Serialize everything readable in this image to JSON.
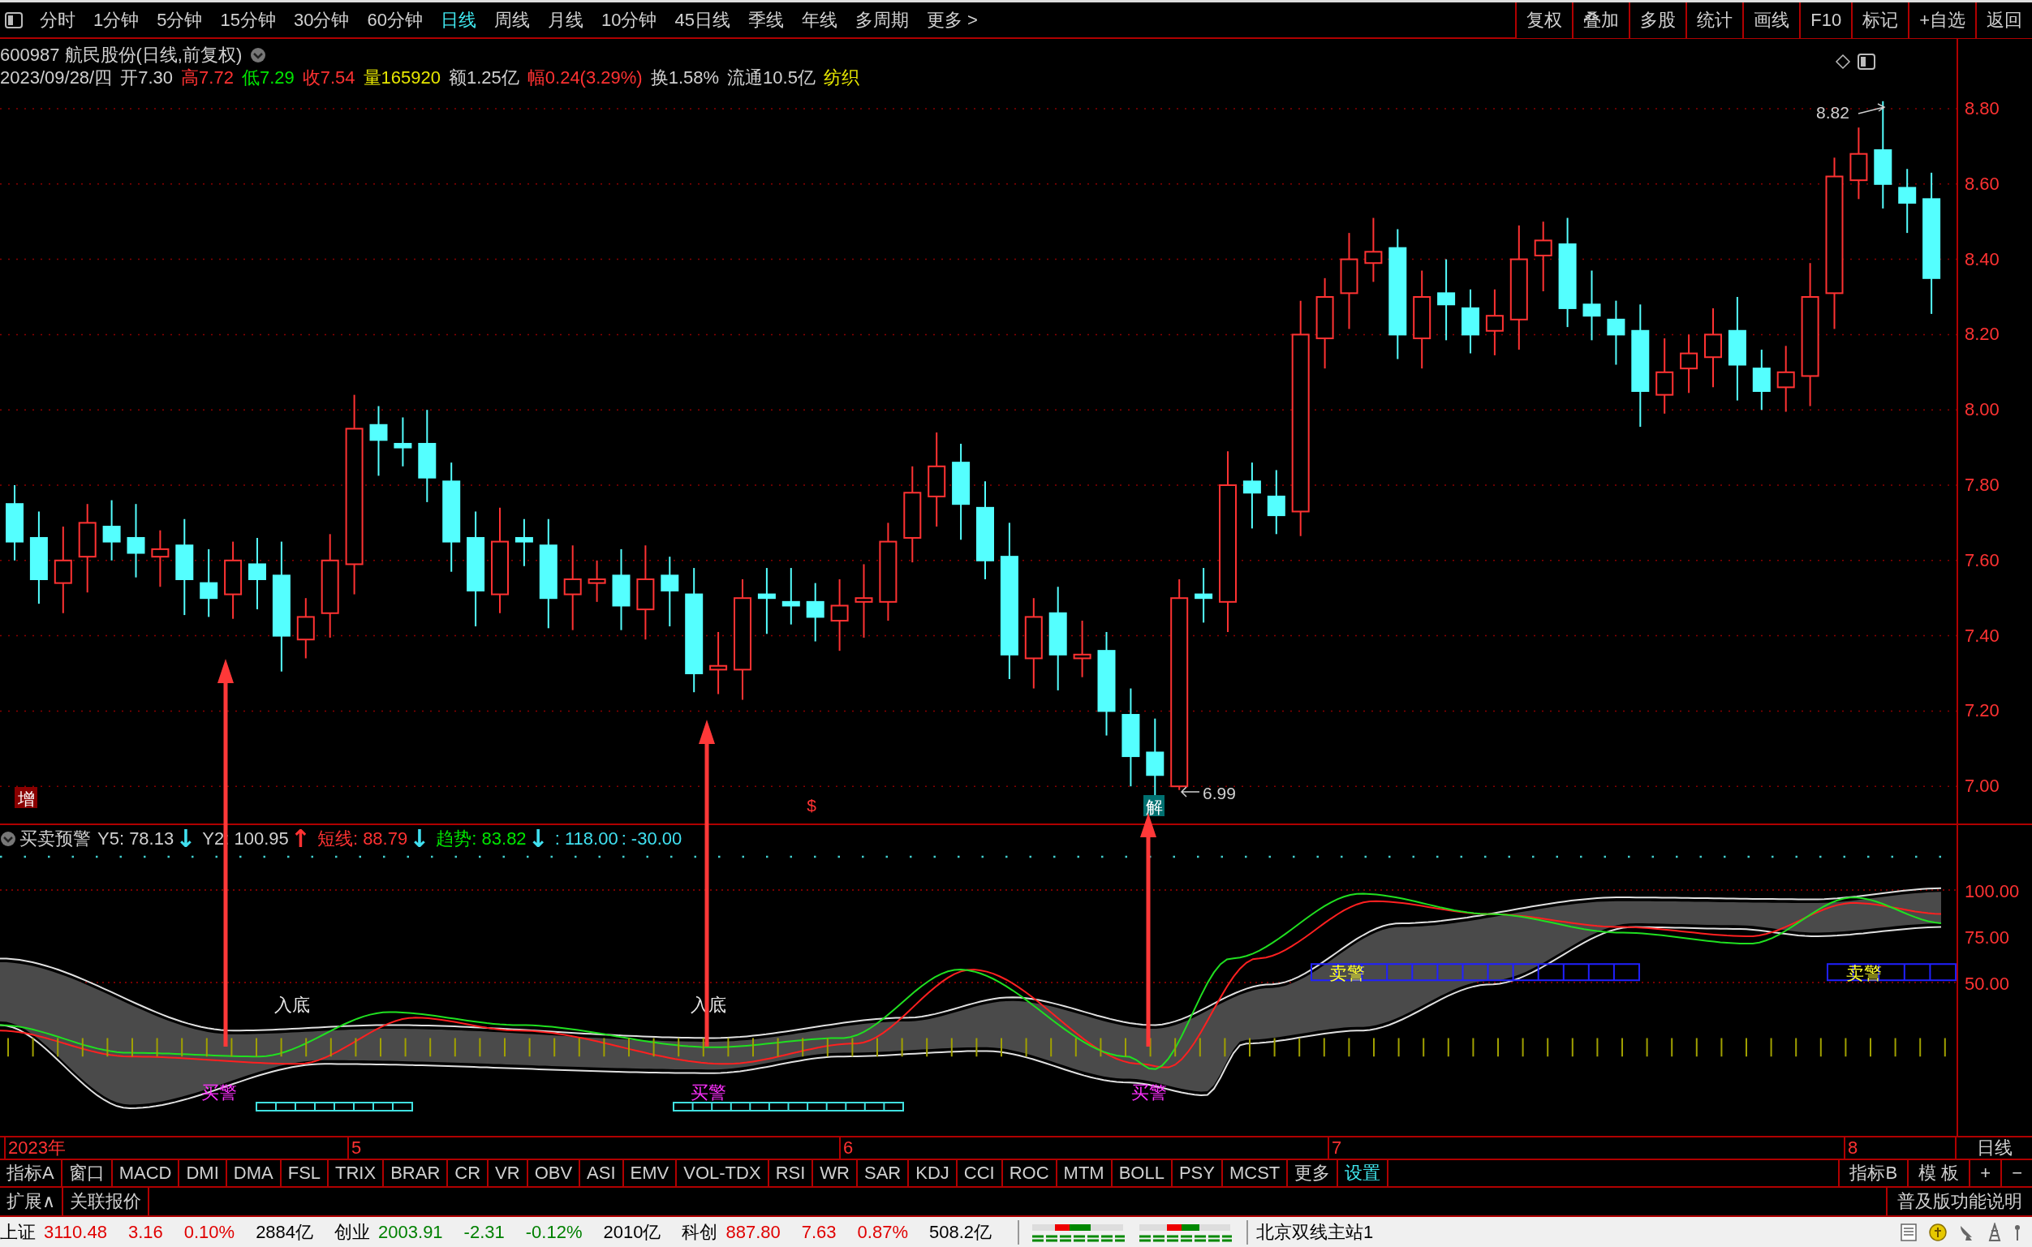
{
  "toolbar": {
    "periods": [
      {
        "label": "分时",
        "selected": false
      },
      {
        "label": "1分钟",
        "selected": false
      },
      {
        "label": "5分钟",
        "selected": false
      },
      {
        "label": "15分钟",
        "selected": false
      },
      {
        "label": "30分钟",
        "selected": false
      },
      {
        "label": "60分钟",
        "selected": false
      },
      {
        "label": "日线",
        "selected": true
      },
      {
        "label": "周线",
        "selected": false
      },
      {
        "label": "月线",
        "selected": false
      },
      {
        "label": "10分钟",
        "selected": false
      },
      {
        "label": "45日线",
        "selected": false
      },
      {
        "label": "季线",
        "selected": false
      },
      {
        "label": "年线",
        "selected": false
      },
      {
        "label": "多周期",
        "selected": false
      },
      {
        "label": "更多 >",
        "selected": false
      }
    ],
    "actions": [
      "复权",
      "叠加",
      "多股",
      "统计",
      "画线",
      "F10",
      "标记",
      "+自选",
      "返回"
    ]
  },
  "quote": {
    "title": "600987 航民股份(日线,前复权)",
    "fields": [
      {
        "text": "2023/09/28/四",
        "color": "#d0d0d0"
      },
      {
        "text": "开7.30",
        "color": "#d0d0d0"
      },
      {
        "text": "高7.72",
        "color": "#ff3232"
      },
      {
        "text": "低7.29",
        "color": "#00e600"
      },
      {
        "text": "收7.54",
        "color": "#ff3232"
      },
      {
        "text": "量165920",
        "color": "#e6e600"
      },
      {
        "text": "额1.25亿",
        "color": "#d0d0d0"
      },
      {
        "text": "幅0.24(3.29%)",
        "color": "#ff3232"
      },
      {
        "text": "换1.58%",
        "color": "#d0d0d0"
      },
      {
        "text": "流通10.5亿",
        "color": "#d0d0d0"
      },
      {
        "text": "纺织",
        "color": "#e6e600"
      }
    ]
  },
  "price_axis": [
    "8.80",
    "8.60",
    "8.40",
    "8.20",
    "8.00",
    "7.80",
    "7.60",
    "7.40",
    "7.20",
    "7.00"
  ],
  "price_marks": {
    "high": "8.82",
    "low": "6.99"
  },
  "markers": [
    {
      "text": "增",
      "kind": "red-box"
    },
    {
      "text": "$",
      "kind": "plain"
    },
    {
      "text": "解",
      "kind": "teal-box"
    }
  ],
  "indicator": {
    "name": "买卖预警",
    "values": [
      {
        "text": "Y5: 78.13",
        "color": "#d0d0d0",
        "arrow": {
          "text": "↓",
          "color": "#40e0f0"
        }
      },
      {
        "text": "Y2: 100.95",
        "color": "#d0d0d0",
        "arrow": {
          "text": "↑",
          "color": "#ff3232"
        }
      },
      {
        "text": "短线: 88.79",
        "color": "#ff3232",
        "arrow": {
          "text": "↓",
          "color": "#40e0f0"
        }
      },
      {
        "text": "趋势: 83.82",
        "color": "#00e600",
        "arrow": {
          "text": "↓",
          "color": "#40e0f0"
        }
      },
      {
        "text": ": 118.00",
        "color": "#40e0f0"
      },
      {
        "text": ": -30.00",
        "color": "#40e0f0"
      }
    ],
    "axis": [
      "100.00",
      "75.00",
      "50.00"
    ],
    "signals": [
      {
        "text": "入底",
        "kind": "bottom"
      },
      {
        "text": "入底",
        "kind": "bottom"
      },
      {
        "text": "买警",
        "kind": "buy"
      },
      {
        "text": "买警",
        "kind": "buy"
      },
      {
        "text": "买警",
        "kind": "buy"
      },
      {
        "text": "卖警",
        "kind": "sell"
      },
      {
        "text": "卖警",
        "kind": "sell"
      }
    ]
  },
  "date_axis": {
    "labels": [
      "2023年",
      "5",
      "6",
      "7",
      "8"
    ],
    "period": "日线"
  },
  "indicator_tabs": {
    "left": [
      {
        "label": "指标A",
        "kind": "plain"
      },
      {
        "label": "窗口",
        "kind": "plain"
      },
      {
        "label": "MACD",
        "kind": "plain"
      },
      {
        "label": "DMI",
        "kind": "plain"
      },
      {
        "label": "DMA",
        "kind": "plain"
      },
      {
        "label": "FSL",
        "kind": "plain"
      },
      {
        "label": "TRIX",
        "kind": "plain"
      },
      {
        "label": "BRAR",
        "kind": "plain"
      },
      {
        "label": "CR",
        "kind": "plain"
      },
      {
        "label": "VR",
        "kind": "plain"
      },
      {
        "label": "OBV",
        "kind": "plain"
      },
      {
        "label": "ASI",
        "kind": "plain"
      },
      {
        "label": "EMV",
        "kind": "plain"
      },
      {
        "label": "VOL-TDX",
        "kind": "plain"
      },
      {
        "label": "RSI",
        "kind": "plain"
      },
      {
        "label": "WR",
        "kind": "plain"
      },
      {
        "label": "SAR",
        "kind": "plain"
      },
      {
        "label": "KDJ",
        "kind": "plain"
      },
      {
        "label": "CCI",
        "kind": "plain"
      },
      {
        "label": "ROC",
        "kind": "plain"
      },
      {
        "label": "MTM",
        "kind": "plain"
      },
      {
        "label": "BOLL",
        "kind": "plain"
      },
      {
        "label": "PSY",
        "kind": "plain"
      },
      {
        "label": "MCST",
        "kind": "plain"
      },
      {
        "label": "更多",
        "kind": "plain"
      },
      {
        "label": "设置",
        "kind": "setting"
      }
    ],
    "right": [
      "指标B",
      "模 板",
      "+",
      "−"
    ]
  },
  "extension_row": {
    "left": [
      "扩展∧",
      "关联报价"
    ],
    "right": "普及版功能说明"
  },
  "status_bar": {
    "items": [
      {
        "text": "上证",
        "color": "#000000"
      },
      {
        "text": "3110.48",
        "color": "#e00000"
      },
      {
        "text": "3.16",
        "color": "#e00000"
      },
      {
        "text": "0.10%",
        "color": "#e00000"
      },
      {
        "text": "2884亿",
        "color": "#000000"
      },
      {
        "text": "创业",
        "color": "#000000"
      },
      {
        "text": "2003.91",
        "color": "#008000"
      },
      {
        "text": "-2.31",
        "color": "#008000"
      },
      {
        "text": "-0.12%",
        "color": "#008000"
      },
      {
        "text": "2010亿",
        "color": "#000000"
      },
      {
        "text": "科创",
        "color": "#000000"
      },
      {
        "text": "887.80",
        "color": "#e00000"
      },
      {
        "text": "7.63",
        "color": "#e00000"
      },
      {
        "text": "0.87%",
        "color": "#e00000"
      },
      {
        "text": "508.2亿",
        "color": "#000000"
      }
    ],
    "server": "北京双线主站1"
  }
}
